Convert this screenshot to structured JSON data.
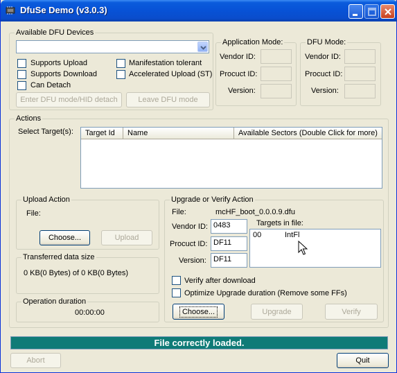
{
  "window": {
    "title": "DfuSe Demo (v3.0.3)"
  },
  "devices": {
    "group_label": "Available DFU Devices",
    "selected": "",
    "checkboxes": {
      "supports_upload": "Supports Upload",
      "supports_download": "Supports Download",
      "can_detach": "Can Detach",
      "manifestation_tolerant": "Manifestation tolerant",
      "accelerated_upload": "Accelerated Upload (ST)"
    },
    "enter_dfu_button": "Enter DFU mode/HID detach",
    "leave_dfu_button": "Leave DFU mode"
  },
  "app_mode": {
    "label": "Application Mode:",
    "vendor_label": "Vendor ID:",
    "product_label": "Procuct ID:",
    "version_label": "Version:",
    "vendor": "",
    "product": "",
    "version": ""
  },
  "dfu_mode": {
    "label": "DFU Mode:",
    "vendor_label": "Vendor ID:",
    "product_label": "Procuct ID:",
    "version_label": "Version:",
    "vendor": "",
    "product": "",
    "version": ""
  },
  "actions": {
    "group_label": "Actions",
    "select_targets_label": "Select Target(s):",
    "columns": [
      "Target Id",
      "Name",
      "Available Sectors (Double Click for more)"
    ]
  },
  "upload_action": {
    "label": "Upload Action",
    "file_label": "File:",
    "choose_button": "Choose...",
    "upload_button": "Upload"
  },
  "transferred": {
    "label": "Transferred data size",
    "value": "0 KB(0 Bytes) of 0 KB(0 Bytes)"
  },
  "operation": {
    "label": "Operation duration",
    "value": "00:00:00"
  },
  "upgrade": {
    "label": "Upgrade or Verify Action",
    "file_label": "File:",
    "file_value": "mcHF_boot_0.0.0.9.dfu",
    "vendor_label": "Vendor ID:",
    "vendor": "0483",
    "product_label": "Procuct ID:",
    "product": "DF11",
    "version_label": "Version:",
    "version": "DF11",
    "targets_label": "Targets in file:",
    "targets": [
      {
        "id": "00",
        "name": "IntFl"
      }
    ],
    "verify_after_download": "Verify after download",
    "optimize": "Optimize Upgrade duration (Remove some FFs)",
    "choose_button": "Choose...",
    "upgrade_button": "Upgrade",
    "verify_button": "Verify"
  },
  "status": {
    "text": "File correctly loaded."
  },
  "footer": {
    "abort_button": "Abort",
    "quit_button": "Quit"
  },
  "colors": {
    "status_bg": "#0f7b77",
    "titlebar": "#0752d6"
  }
}
